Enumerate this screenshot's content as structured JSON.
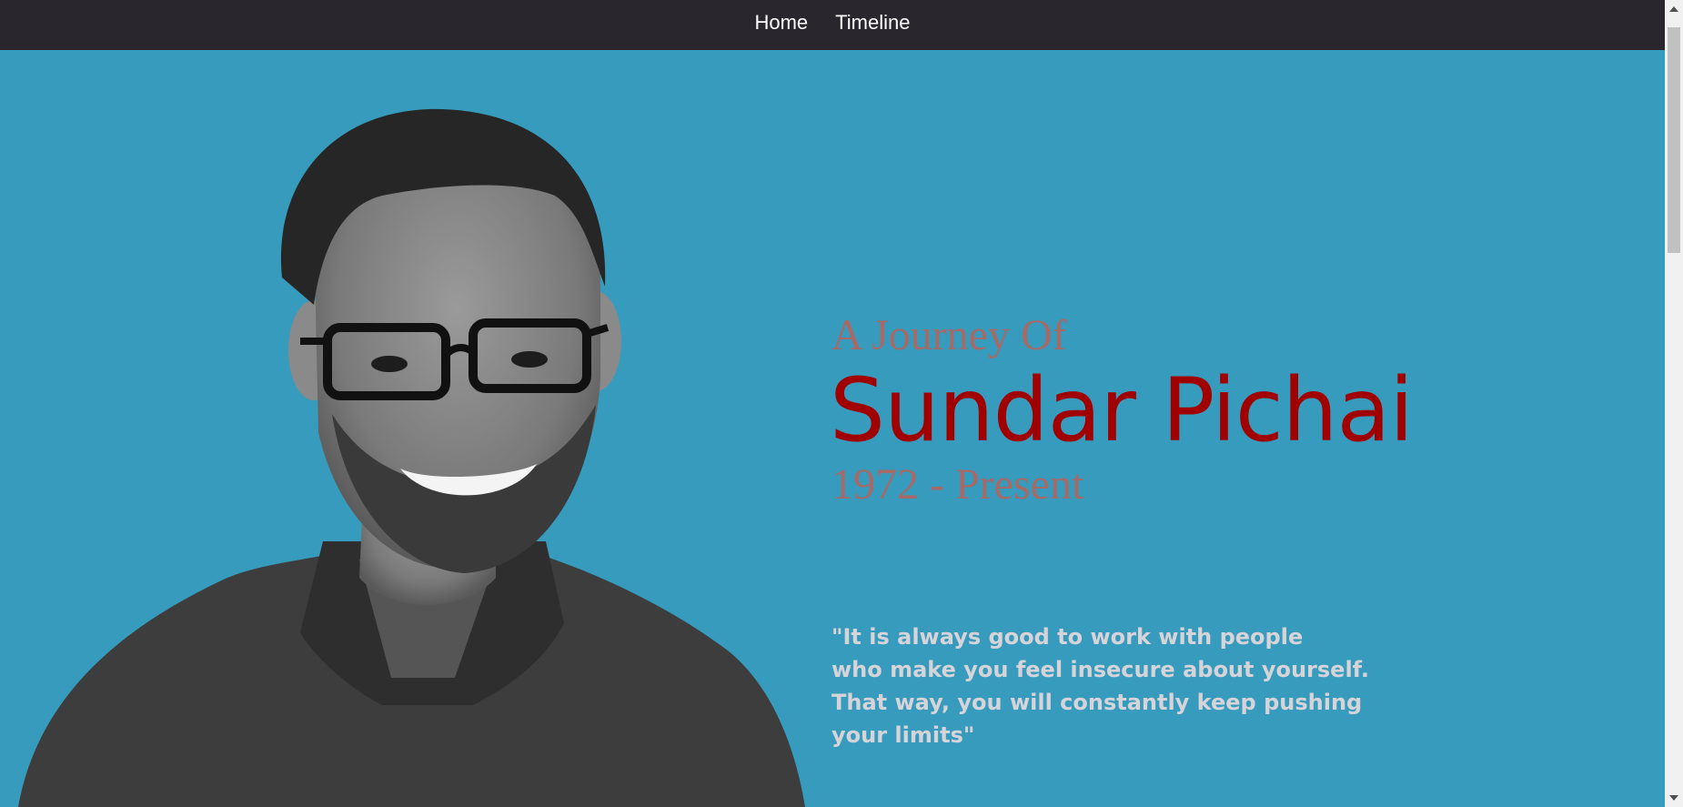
{
  "nav": {
    "items": [
      {
        "label": "Home"
      },
      {
        "label": "Timeline"
      }
    ]
  },
  "hero": {
    "intro": "A Journey Of",
    "name": "Sundar Pichai",
    "years": "1972 - Present",
    "quote": "\"It is always good to work with people\nwho make you feel insecure about yourself.\nThat way, you will constantly keep pushing\nyour limits\""
  },
  "colors": {
    "background": "#379bbd",
    "navbar": "#29272d",
    "name": "#a00000",
    "subtitle": "#a86a67",
    "quote": "#d6d4d8"
  },
  "icons": {
    "scroll_up": "scroll-up-arrow-icon",
    "scroll_down": "scroll-down-arrow-icon"
  }
}
